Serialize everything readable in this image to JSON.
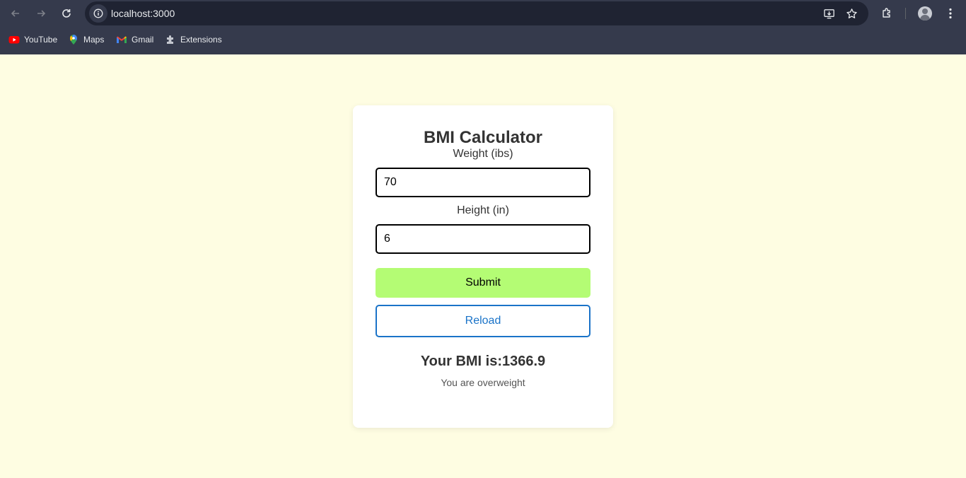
{
  "browser": {
    "url": "localhost:3000",
    "bookmarks": [
      {
        "label": "YouTube",
        "icon": "youtube-icon"
      },
      {
        "label": "Maps",
        "icon": "maps-icon"
      },
      {
        "label": "Gmail",
        "icon": "gmail-icon"
      },
      {
        "label": "Extensions",
        "icon": "puzzle-icon"
      }
    ]
  },
  "calculator": {
    "title": "BMI Calculator",
    "weight_label": "Weight (ibs)",
    "weight_value": "70",
    "height_label": "Height (in)",
    "height_value": "6",
    "submit_label": "Submit",
    "reload_label": "Reload",
    "result_text": "Your BMI is:1366.9",
    "status_text": "You are overweight"
  },
  "colors": {
    "page_background": "#fefde2",
    "submit_background": "#b4fc74",
    "reload_accent": "#1a73c8",
    "chrome_background": "#353a4c"
  }
}
